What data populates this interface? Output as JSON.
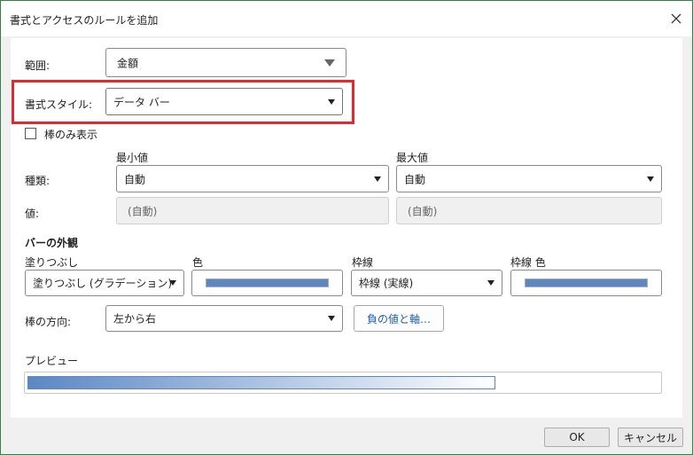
{
  "dialog": {
    "title": "書式とアクセスのルールを追加"
  },
  "range": {
    "label": "範囲:",
    "value": "金額"
  },
  "format_style": {
    "label": "書式スタイル:",
    "value": "データ バー"
  },
  "bar_only": {
    "label": "棒のみ表示",
    "checked": false
  },
  "min": {
    "header": "最小値",
    "type_value": "自動",
    "value_placeholder": "(自動)"
  },
  "max": {
    "header": "最大値",
    "type_value": "自動",
    "value_placeholder": "(自動)"
  },
  "row_labels": {
    "type": "種類:",
    "value": "値:"
  },
  "bar_appearance": {
    "heading": "バーの外観",
    "fill_label": "塗りつぶし",
    "fill_value": "塗りつぶし (グラデーション)",
    "color_label": "色",
    "fill_color": "#5b87c5",
    "border_label": "枠線",
    "border_value": "枠線 (実線)",
    "border_color_label": "枠線 色",
    "border_color": "#5b87c5"
  },
  "direction": {
    "label": "棒の方向:",
    "value": "左から右"
  },
  "negative_button": "負の値と軸…",
  "preview": {
    "label": "プレビュー",
    "fill_fraction": 0.74
  },
  "footer": {
    "ok": "OK",
    "cancel": "キャンセル"
  }
}
